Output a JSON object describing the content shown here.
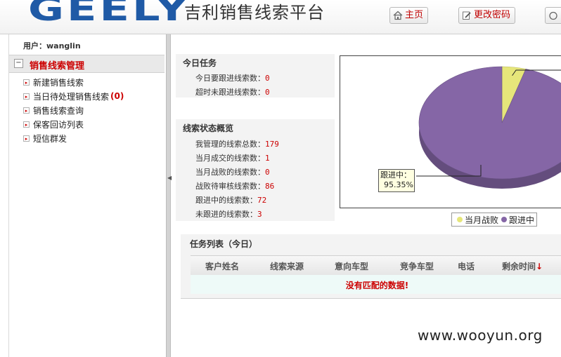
{
  "header": {
    "logo": "GEELY",
    "title": "吉利销售线索平台",
    "buttons": {
      "home": "主页",
      "change_password": "更改密码"
    }
  },
  "sidebar": {
    "user_label": "用户：wanglin",
    "section_title": "销售线索管理",
    "items": [
      {
        "label": "新建销售线索"
      },
      {
        "label": "当日待处理销售线索",
        "count": "(0)"
      },
      {
        "label": "销售线索查询"
      },
      {
        "label": "保客回访列表"
      },
      {
        "label": "短信群发"
      }
    ]
  },
  "today_tasks": {
    "title": "今日任务",
    "rows": [
      {
        "label": "今日要跟进线索数：",
        "value": "0"
      },
      {
        "label": "超时未跟进线索数：",
        "value": "0"
      }
    ]
  },
  "status_overview": {
    "title": "线索状态概览",
    "rows": [
      {
        "label": "我管理的线索总数：",
        "value": "179"
      },
      {
        "label": "当月成交的线索数：",
        "value": "1"
      },
      {
        "label": "当月战败的线索数：",
        "value": "0"
      },
      {
        "label": "战败待审核线索数：",
        "value": "86"
      },
      {
        "label": "跟进中的线索数：",
        "value": "72"
      },
      {
        "label": "未跟进的线索数：",
        "value": "3"
      }
    ]
  },
  "chart_data": {
    "type": "pie",
    "categories": [
      "当月战败",
      "跟进中"
    ],
    "values": [
      4.65,
      95.35
    ],
    "colors": [
      "#e6e67a",
      "#8566a6"
    ],
    "tooltip": {
      "label": "跟进中：",
      "value": "95.35%"
    },
    "legend_position": "bottom-right"
  },
  "task_list": {
    "title": "任务列表（今日）",
    "columns": [
      "客户姓名",
      "线索来源",
      "意向车型",
      "竞争车型",
      "电话",
      "剩余时间"
    ],
    "sort_icon": "↓",
    "empty_message": "没有匹配的数据!"
  },
  "watermark": "www.wooyun.org"
}
